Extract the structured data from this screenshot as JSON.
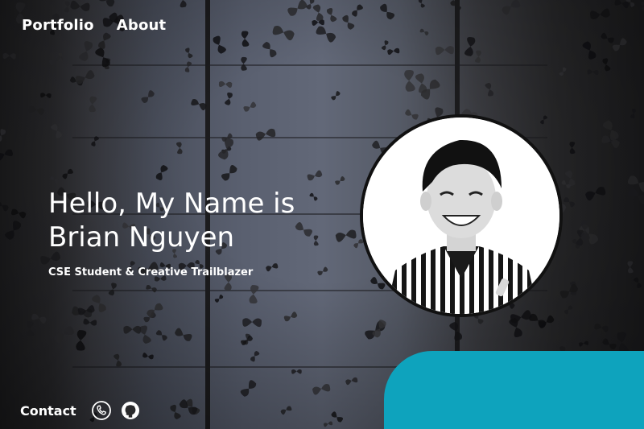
{
  "nav": {
    "items": [
      {
        "label": "Portfolio"
      },
      {
        "label": "About"
      }
    ]
  },
  "hero": {
    "headline_line1": "Hello, My Name is",
    "headline_line2": "Brian Nguyen",
    "tagline": "CSE Student & Creative Trailblazer"
  },
  "footer": {
    "contact_label": "Contact",
    "icons": [
      "phone-icon",
      "github-icon"
    ]
  },
  "colors": {
    "accent": "#0ea3bd",
    "text": "#ffffff"
  }
}
